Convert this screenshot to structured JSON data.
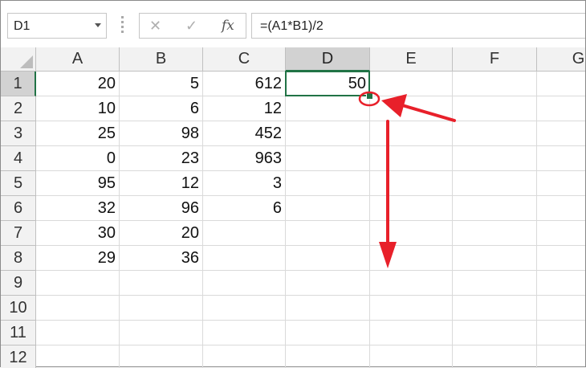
{
  "formula_bar": {
    "name_box": "D1",
    "cancel_icon": "✕",
    "enter_icon": "✓",
    "fx_label": "fx",
    "formula": "=(A1*B1)/2"
  },
  "columns": [
    "A",
    "B",
    "C",
    "D",
    "E",
    "F",
    "G"
  ],
  "rows": [
    "1",
    "2",
    "3",
    "4",
    "5",
    "6",
    "7",
    "8",
    "9",
    "10",
    "11",
    "12"
  ],
  "cells": [
    [
      "20",
      "5",
      "612",
      "50",
      "",
      "",
      ""
    ],
    [
      "10",
      "6",
      "12",
      "",
      "",
      "",
      ""
    ],
    [
      "25",
      "98",
      "452",
      "",
      "",
      "",
      ""
    ],
    [
      "0",
      "23",
      "963",
      "",
      "",
      "",
      ""
    ],
    [
      "95",
      "12",
      "3",
      "",
      "",
      "",
      ""
    ],
    [
      "32",
      "96",
      "6",
      "",
      "",
      "",
      ""
    ],
    [
      "30",
      "20",
      "",
      "",
      "",
      "",
      ""
    ],
    [
      "29",
      "36",
      "",
      "",
      "",
      "",
      ""
    ],
    [
      "",
      "",
      "",
      "",
      "",
      "",
      ""
    ],
    [
      "",
      "",
      "",
      "",
      "",
      "",
      ""
    ],
    [
      "",
      "",
      "",
      "",
      "",
      "",
      ""
    ],
    [
      "",
      "",
      "",
      "",
      "",
      "",
      ""
    ]
  ],
  "selection": {
    "column": "D",
    "row": "1"
  },
  "colors": {
    "selection_accent": "#217346",
    "annotation_red": "#e8202a"
  },
  "annotations": [
    "fill-handle-circle",
    "arrow-pointing-to-fill-handle",
    "arrow-drag-down"
  ]
}
